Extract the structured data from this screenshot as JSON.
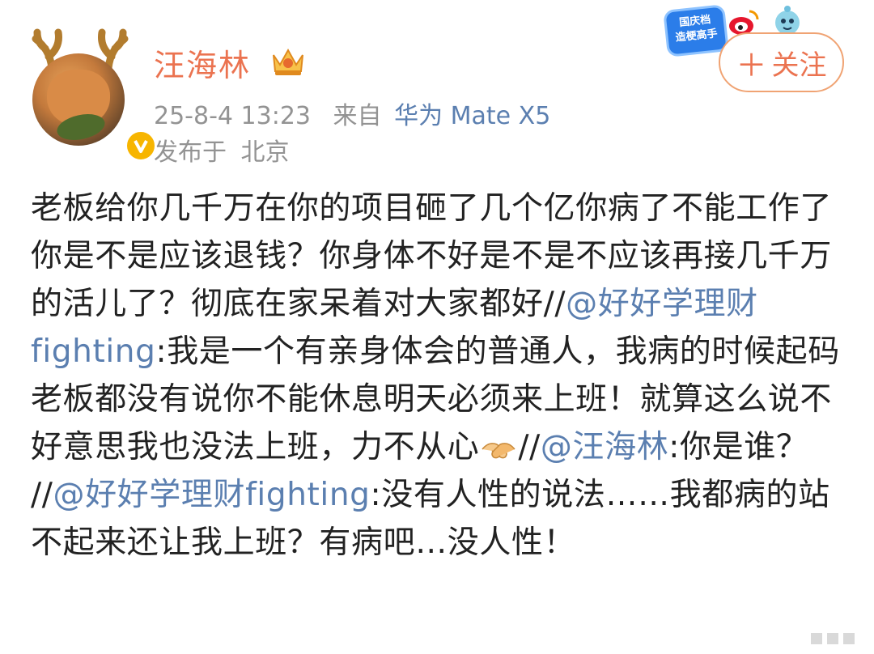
{
  "profile": {
    "username": "汪海林",
    "timestamp": "25-8-4 13:23",
    "source_label": "来自",
    "device": "华为 Mate X5",
    "location_prefix": "发布于",
    "location": "北京"
  },
  "header": {
    "event_badge_line1": "国庆档",
    "event_badge_line2": "造梗高手",
    "follow_label": "关注",
    "follow_plus": "＋"
  },
  "post": {
    "seg1": "老板给你几千万在你的项目砸了几个亿你病了不能工作了你是不是应该退钱？你身体不好是不是不应该再接几千万的活儿了？彻底在家呆着对大家都好//",
    "mention1": "@好好学理财fighting",
    "seg2": ":我是一个有亲身体会的普通人，我病的时候起码老板都没有说你不能休息明天必须来上班！就算这么说不好意思我也没法上班，力不从心",
    "seg3": "//",
    "mention2": "@汪海林",
    "seg4": ":你是谁？ //",
    "mention3": "@好好学理财fighting",
    "seg5": ":没有人性的说法……我都病的站不起来还让我上班？有病吧…没人性！"
  },
  "colors": {
    "username": "#eb7350",
    "mention": "#5b7fb0",
    "meta": "#939393",
    "follow_border": "#f0a373",
    "badge_gold": "#f7b500"
  },
  "icons": [
    "antlers-icon",
    "crown-icon",
    "verified-badge-icon",
    "weibo-logo-icon",
    "mascot-icon",
    "handshake-icon"
  ]
}
